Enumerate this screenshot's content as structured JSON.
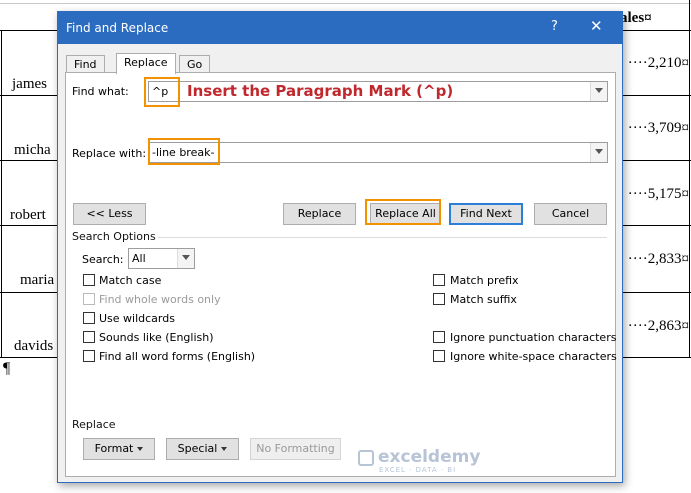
{
  "document": {
    "header_fragment": "ales¤",
    "rows": [
      {
        "name": "james",
        "value": "····2,210¤"
      },
      {
        "name": "micha",
        "value": "····3,709¤"
      },
      {
        "name": "robert",
        "value": "····5,175¤"
      },
      {
        "name": "maria",
        "value": "····2,833¤"
      },
      {
        "name": "davids",
        "value": "····2,863¤"
      }
    ],
    "pilcrow": "¶"
  },
  "dialog": {
    "title": "Find and Replace",
    "help_glyph": "?",
    "close_glyph": "✕",
    "tabs": [
      "Find",
      "Replace",
      "Go To"
    ],
    "active_tab": "Replace",
    "find_label": "Find what:",
    "find_value": "^p",
    "annotation_prefix": "Insert the ",
    "annotation_highlight": "Paragraph Mark (^p)",
    "replace_label": "Replace with:",
    "replace_value": "-line break-",
    "buttons": {
      "less": "<< Less",
      "replace": "Replace",
      "replace_all": "Replace All",
      "find_next": "Find Next",
      "cancel": "Cancel"
    },
    "search_options_label": "Search Options",
    "search_label": "Search:",
    "search_value": "All",
    "options_left": [
      {
        "label": "Match case",
        "checked": false,
        "enabled": true
      },
      {
        "label": "Find whole words only",
        "checked": false,
        "enabled": false
      },
      {
        "label": "Use wildcards",
        "checked": false,
        "enabled": true
      },
      {
        "label": "Sounds like (English)",
        "checked": false,
        "enabled": true
      },
      {
        "label": "Find all word forms (English)",
        "checked": false,
        "enabled": true
      }
    ],
    "options_right": [
      {
        "label": "Match prefix",
        "checked": false,
        "enabled": true
      },
      {
        "label": "Match suffix",
        "checked": false,
        "enabled": true
      },
      {
        "label": "Ignore punctuation characters",
        "checked": false,
        "enabled": true
      },
      {
        "label": "Ignore white-space characters",
        "checked": false,
        "enabled": true
      }
    ],
    "replace_section_label": "Replace",
    "format_button": "Format",
    "special_button": "Special",
    "no_formatting_button": "No Formatting",
    "watermark": {
      "name": "exceldemy",
      "tagline": "EXCEL · DATA · BI"
    }
  },
  "colors": {
    "title_bar": "#2b6cc0",
    "highlight_box": "#f39200",
    "annotation_text": "#c0282d",
    "default_button_border": "#2b7fd6"
  }
}
